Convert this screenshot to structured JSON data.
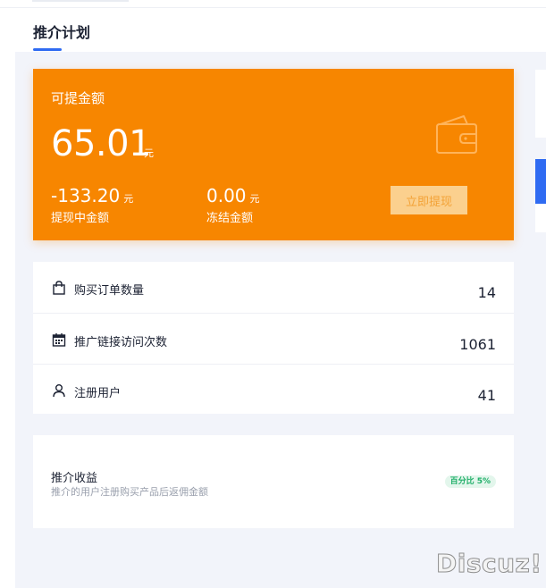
{
  "header": {
    "title": "推介计划"
  },
  "balance": {
    "label": "可提金额",
    "amount": "65.01",
    "unit": "元",
    "pending_amount": "-133.20",
    "pending_unit": "元",
    "pending_label": "提现中金额",
    "frozen_amount": "0.00",
    "frozen_unit": "元",
    "frozen_label": "冻结金额",
    "withdraw_button": "立即提现",
    "icon": "wallet-icon"
  },
  "stats": [
    {
      "icon": "bag-icon",
      "label": "购买订单数量",
      "value": "14"
    },
    {
      "icon": "calendar-icon",
      "label": "推广链接访问次数",
      "value": "1061"
    },
    {
      "icon": "user-icon",
      "label": "注册用户",
      "value": "41"
    }
  ],
  "referral": {
    "title": "推介收益",
    "description": "推介的用户注册购买产品后返佣金额",
    "badge": "百分比 5%"
  },
  "colors": {
    "accent": "#2f6bf2",
    "card_orange": "#f78600",
    "badge_green": "#23b06b"
  },
  "watermark": "Discuz!"
}
